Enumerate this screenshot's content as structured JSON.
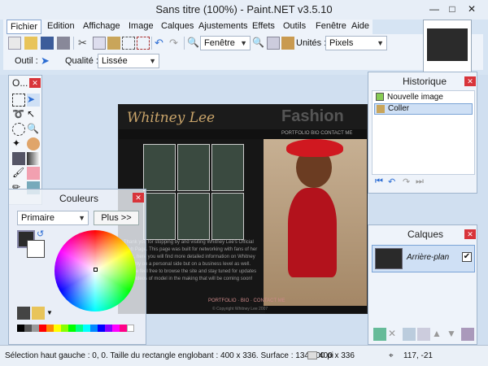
{
  "window": {
    "title": "Sans titre (100%) - Paint.NET v3.5.10"
  },
  "menu": [
    "Fichier",
    "Edition",
    "Affichage",
    "Image",
    "Calques",
    "Ajustements",
    "Effets",
    "Outils",
    "Fenêtre",
    "Aide"
  ],
  "toolbar": {
    "zoom_select": "Fenêtre",
    "units_label": "Unités :",
    "units_select": "Pixels",
    "tool_label": "Outil :",
    "quality_label": "Qualité :",
    "quality_select": "Lissée"
  },
  "tools_panel": {
    "title": "O..."
  },
  "colors_panel": {
    "title": "Couleurs",
    "mode_select": "Primaire",
    "more_button": "Plus >>"
  },
  "history_panel": {
    "title": "Historique",
    "items": [
      "Nouvelle image",
      "Coller"
    ]
  },
  "layers_panel": {
    "title": "Calques",
    "layer_name": "Arrière-plan"
  },
  "document": {
    "name": "Whitney Lee",
    "brand": "Fashion",
    "nav": "PORTFOLIO  BIO  CONTACT ME",
    "body": "Thank you for stopping by and visiting Whitney Lee's Official Web Page. This page was built for networking with fans of her work, here you will find more detailed information on Whitney not only on a personal side but on a business level as well. Please feel free to browse the site and stay tuned for updates and videos of model in the making that will be coming soon!",
    "footer": "PORTFOLIO · BIO · CONTACT ME",
    "copyright": "© Copyright Whitney Lee 2007"
  },
  "status": {
    "selection": "Sélection haut gauche : 0, 0. Taille du rectangle englobant : 400 x 336. Surface : 134 400 pi",
    "size": "400 x 336",
    "pointer": "117, -21"
  },
  "colors": {
    "accent": "#2b6cd3",
    "close": "#d8343a"
  }
}
